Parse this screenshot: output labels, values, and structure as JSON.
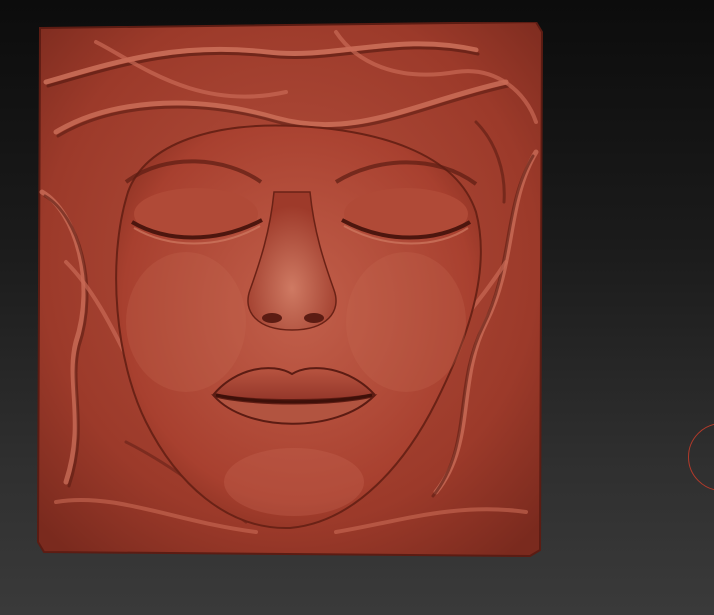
{
  "viewport": {
    "background": [
      "#0c0c0c",
      "#3a3a3a"
    ]
  },
  "model": {
    "name": "relief-face-sculpt-icon",
    "material_color": "#a8402f",
    "highlight_color": "#c96a55",
    "shadow_color": "#5c1c13"
  },
  "gizmo": {
    "icon": "navigation-circle-icon",
    "color": "#b23a2a"
  }
}
